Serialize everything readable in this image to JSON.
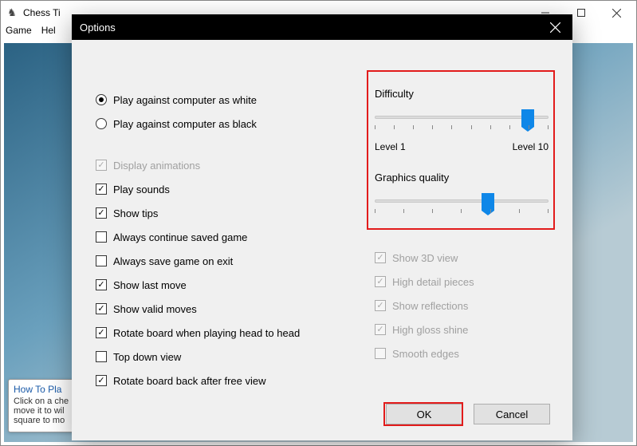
{
  "parent": {
    "title": "Chess Ti",
    "menu": {
      "game": "Game",
      "help": "Hel"
    }
  },
  "howto": {
    "title": "How To Pla",
    "line1": "Click on a che",
    "line2": "move it to wil",
    "line3": "square to mo"
  },
  "dialog": {
    "title": "Options",
    "radios": {
      "white": "Play against computer as white",
      "black": "Play against computer as black"
    },
    "checks": {
      "display_animations": "Display animations",
      "play_sounds": "Play sounds",
      "show_tips": "Show tips",
      "always_continue": "Always continue saved game",
      "always_save": "Always save game on exit",
      "show_last_move": "Show last move",
      "show_valid_moves": "Show valid moves",
      "rotate_head_to_head": "Rotate board when playing head to head",
      "top_down": "Top down view",
      "rotate_back": "Rotate board back after free view"
    },
    "sliders": {
      "difficulty": {
        "label": "Difficulty",
        "min_label": "Level 1",
        "max_label": "Level 10",
        "value_pct": 88
      },
      "graphics": {
        "label": "Graphics quality",
        "value_pct": 65
      }
    },
    "gfx_checks": {
      "show_3d": "Show 3D view",
      "high_detail": "High detail pieces",
      "reflections": "Show reflections",
      "gloss": "High gloss shine",
      "smooth": "Smooth edges"
    },
    "buttons": {
      "ok": "OK",
      "cancel": "Cancel"
    }
  }
}
